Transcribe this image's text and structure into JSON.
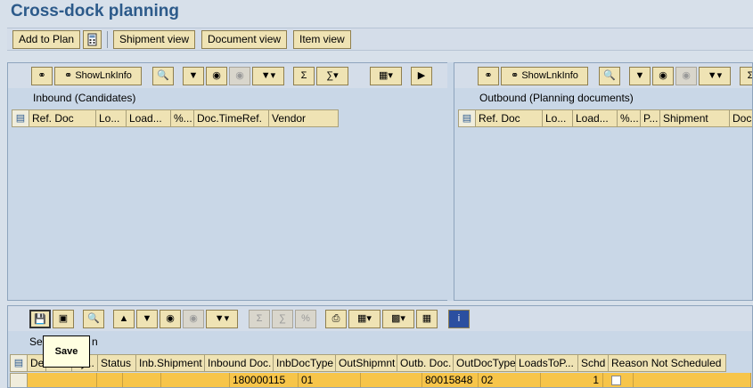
{
  "title": "Cross-dock planning",
  "app_toolbar": {
    "add_to_plan": "Add to Plan",
    "shipment_view": "Shipment view",
    "document_view": "Document view",
    "item_view": "Item view"
  },
  "inbound": {
    "caption": "Inbound (Candidates)",
    "show_link_info": "ShowLnkInfo",
    "columns": [
      "Ref. Doc",
      "Lo...",
      "Load...",
      "%...",
      "Doc.TimeRef.",
      "Vendor"
    ]
  },
  "outbound": {
    "caption": "Outbound (Planning documents)",
    "show_link_info": "ShowLnkInfo",
    "columns": [
      "Ref. Doc",
      "Lo...",
      "Load...",
      "%...",
      "P...",
      "Shipment",
      "Doc"
    ]
  },
  "bottom": {
    "caption": "Se",
    "caption_tail": "n",
    "columns": [
      "De",
      "a.",
      "Ty...",
      "Status",
      "Inb.Shipment",
      "Inbound Doc.",
      "InbDocType",
      "OutShipmnt",
      "Outb. Doc.",
      "OutDocType",
      "LoadsToP...",
      "Schd",
      "Reason Not Scheduled"
    ],
    "row": {
      "inbound_doc": "180000115",
      "inb_doc_type": "01",
      "outb_doc": "80015848",
      "out_doc_type": "02",
      "loads_to_plan": "1"
    }
  },
  "tooltip": "Save"
}
